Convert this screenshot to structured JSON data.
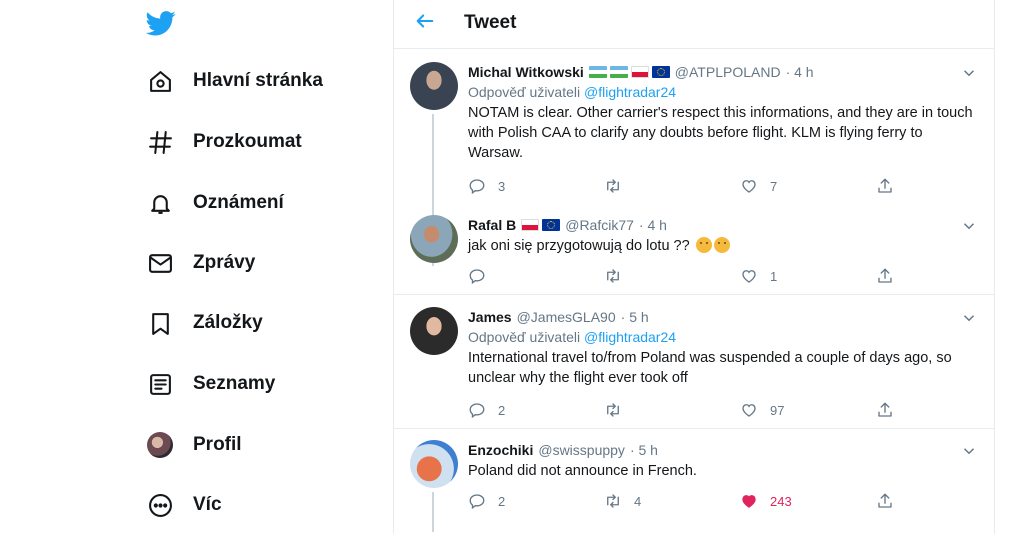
{
  "sidebar": {
    "logo_icon": "twitter-bird-icon",
    "items": [
      {
        "label": "Hlavní stránka",
        "icon": "home-icon"
      },
      {
        "label": "Prozkoumat",
        "icon": "hashtag-icon"
      },
      {
        "label": "Oznámení",
        "icon": "bell-icon"
      },
      {
        "label": "Zprávy",
        "icon": "envelope-icon"
      },
      {
        "label": "Záložky",
        "icon": "bookmark-icon"
      },
      {
        "label": "Seznamy",
        "icon": "list-icon"
      },
      {
        "label": "Profil",
        "icon": "avatar"
      },
      {
        "label": "Víc",
        "icon": "more-circle-icon"
      }
    ]
  },
  "header": {
    "title": "Tweet",
    "back_icon": "arrow-left-icon"
  },
  "colors": {
    "accent": "#1da1f2",
    "like": "#e0245e",
    "text": "#14171a",
    "muted": "#657786",
    "border": "#e6ecf0"
  },
  "tweets": [
    {
      "name": "Michal Witkowski",
      "handle": "@ATPLPOLAND",
      "time": "· 4 h",
      "reply_prefix": "Odpověď uživateli",
      "reply_to": "@flightradar24",
      "text": "NOTAM is clear. Other carrier's respect this informations, and they are in touch with Polish CAA to clarify any doubts before flight. KLM is flying ferry to Warsaw.",
      "replies": "3",
      "retweets": "",
      "likes": "7"
    },
    {
      "name": "Rafal B",
      "handle": "@Rafcik77",
      "time": "· 4 h",
      "text": "jak oni się przygotowują do lotu ??",
      "replies": "",
      "retweets": "",
      "likes": "1"
    },
    {
      "name": "James",
      "handle": "@JamesGLA90",
      "time": "· 5 h",
      "reply_prefix": "Odpověď uživateli",
      "reply_to": "@flightradar24",
      "text": "International travel to/from Poland was suspended a couple of days ago, so unclear why the flight ever took off",
      "replies": "2",
      "retweets": "",
      "likes": "97"
    },
    {
      "name": "Enzochiki",
      "handle": "@swisspuppy",
      "time": "· 5 h",
      "text": "Poland did not announce in French.",
      "replies": "2",
      "retweets": "4",
      "likes": "243"
    }
  ]
}
